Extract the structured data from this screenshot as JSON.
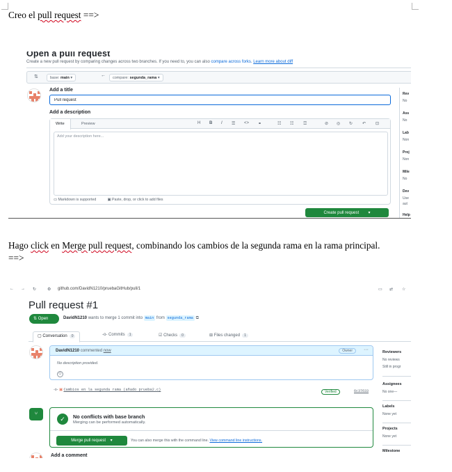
{
  "doc": {
    "line1": {
      "before": "Creo el ",
      "squiggle": "pull request",
      "after": " ==>"
    },
    "para2": {
      "before": "Hago ",
      "sq1": "click",
      "mid1": " en ",
      "sq2": "Merge pull request",
      "after": ", combinando los cambios de la segunda rama en la rama principal.  ==>"
    }
  },
  "open_pr": {
    "heading": "Open a pull request",
    "subtitle_text": "Create a new pull request by comparing changes across two branches. If you need to, you can also ",
    "compare_link": "compare across forks",
    "subtitle_end": ". ",
    "learn_link": "Learn more about diff",
    "base_prefix": "base: ",
    "base_branch": "main",
    "compare_prefix": "compare: ",
    "compare_branch": "segunda_rama",
    "add_title_label": "Add a title",
    "title_value": "Pull request",
    "add_description_label": "Add a description",
    "tab_write": "Write",
    "tab_preview": "Preview",
    "textarea_placeholder": "Add your description here...",
    "markdown_note": "Markdown is supported",
    "paste_note": "Paste, drop, or click to add files",
    "create_button": "Create pull request",
    "sidebar": [
      {
        "head": "Rev",
        "text": "No"
      },
      {
        "head": "Ass",
        "text": "No"
      },
      {
        "head": "Lab",
        "text": "Non"
      },
      {
        "head": "Proj",
        "text": "Non"
      },
      {
        "head": "Mile",
        "text": "No"
      },
      {
        "head": "Dev",
        "text": "Use"
      },
      {
        "head": "",
        "text": "aut"
      },
      {
        "head": "Help",
        "text": ""
      }
    ]
  },
  "pr_view": {
    "url": "github.com/DavidN1210/pruebaGitHub/pull/1",
    "title": "Pull request #1",
    "status": "Open",
    "author": "DavidN1210",
    "meta_mid": " wants to merge 1 commit into ",
    "base_branch": "main",
    "meta_from": " from ",
    "head_branch": "segunda_rama",
    "tabs": [
      {
        "label": "Conversation",
        "count": "0"
      },
      {
        "label": "Commits",
        "count": "1"
      },
      {
        "label": "Checks",
        "count": "0"
      },
      {
        "label": "Files changed",
        "count": "1"
      }
    ],
    "comment_author": "DavidN1210",
    "comment_verb": " commented ",
    "comment_time": "now",
    "owner_badge": "Owner",
    "no_description": "No description provided.",
    "commit_message": "Cambios en la segunda rama (añado prueba2.c)",
    "verified": "Verified",
    "commit_sha": "6c37633",
    "merge_title": "No conflicts with base branch",
    "merge_sub": "Merging can be performed automatically.",
    "merge_button": "Merge pull request",
    "merge_hint": "You can also merge this with the command line. ",
    "merge_hint_link": "View command line instructions.",
    "add_comment": "Add a comment",
    "sidebar": {
      "reviewers_head": "Reviewers",
      "reviewers_1": "No reviews",
      "reviewers_2": "Still in progr",
      "assignees_head": "Assignees",
      "assignees_1": "No one—",
      "labels_head": "Labels",
      "labels_1": "None yet",
      "projects_head": "Projects",
      "projects_1": "None yet",
      "milestone_head": "Milestone"
    }
  },
  "colors": {
    "green": "#1f883d",
    "link": "#0969da",
    "squiggle": "#d0021b"
  }
}
